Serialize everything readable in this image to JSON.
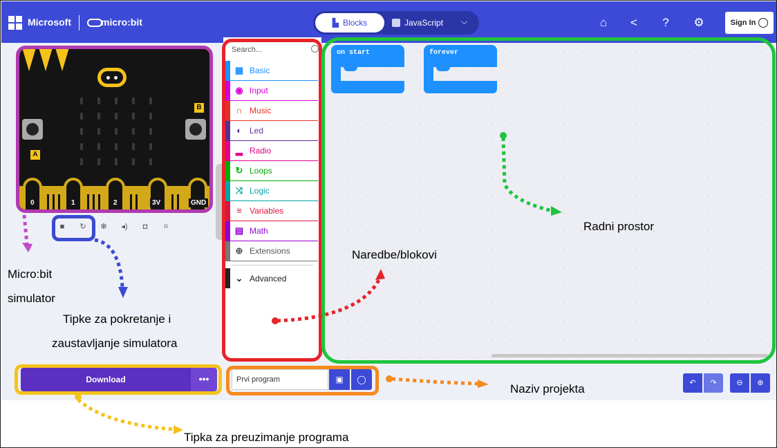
{
  "header": {
    "ms_text": "Microsoft",
    "brand_text": "micro:bit",
    "mode_blocks": "Blocks",
    "mode_js": "JavaScript",
    "sign_in": "Sign In",
    "icons": [
      "home-icon",
      "share-icon",
      "help-icon",
      "settings-icon"
    ]
  },
  "simulator": {
    "pins": [
      "0",
      "1",
      "2",
      "3V",
      "GND"
    ],
    "button_a": "A",
    "button_b": "B",
    "controls": [
      "stop-icon",
      "restart-icon",
      "debug-icon",
      "mute-icon",
      "screenshot-icon",
      "fullscreen-icon"
    ]
  },
  "toolbox": {
    "search_placeholder": "Search...",
    "categories": [
      {
        "label": "Basic",
        "color": "#1e90ff"
      },
      {
        "label": "Input",
        "color": "#d400d4"
      },
      {
        "label": "Music",
        "color": "#e63022"
      },
      {
        "label": "Led",
        "color": "#5c2d91"
      },
      {
        "label": "Radio",
        "color": "#e3008c"
      },
      {
        "label": "Loops",
        "color": "#00aa00"
      },
      {
        "label": "Logic",
        "color": "#00a4a6"
      },
      {
        "label": "Variables",
        "color": "#dc143c"
      },
      {
        "label": "Math",
        "color": "#9400d3"
      },
      {
        "label": "Extensions",
        "color": "#777777"
      }
    ],
    "advanced": "Advanced"
  },
  "workspace": {
    "blocks": [
      "on start",
      "forever"
    ]
  },
  "bottom": {
    "download": "Download",
    "download_more": "•••",
    "project_name": "Prvi program"
  },
  "annotations": {
    "simulator_1": "Micro:bit",
    "simulator_2": "simulator",
    "controls_1": "Tipke za pokretanje i",
    "controls_2": "zaustavljanje simulatora",
    "blocks": "Naredbe/blokovi",
    "workspace": "Radni prostor",
    "project_name": "Naziv projekta",
    "download": "Tipka za preuzimanje programa"
  },
  "colors": {
    "header": "#3c4ad7",
    "frame_simulator": "#b03ab0",
    "frame_controls": "#3b4bd0",
    "frame_toolbox": "#e8232a",
    "frame_workspace": "#1ec43c",
    "frame_download": "#f5c21b",
    "frame_project": "#f58a1f"
  }
}
